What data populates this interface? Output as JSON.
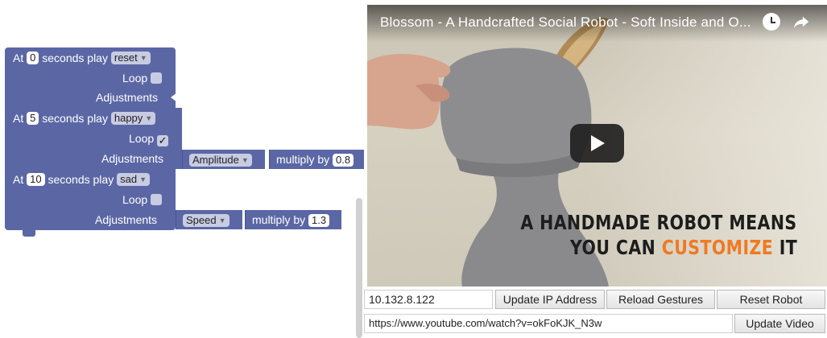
{
  "blocks": [
    {
      "prefix": "At",
      "seconds": "0",
      "mid": "seconds play",
      "gesture": "reset",
      "loop_label": "Loop",
      "loop_checked": "",
      "adjust_label": "Adjustments"
    },
    {
      "prefix": "At",
      "seconds": "5",
      "mid": "seconds play",
      "gesture": "happy",
      "loop_label": "Loop",
      "loop_checked": "✓",
      "adjust_label": "Adjustments",
      "adjust_param": "Amplitude",
      "multiply_label": "multiply by",
      "multiply_value": "0.8"
    },
    {
      "prefix": "At",
      "seconds": "10",
      "mid": "seconds play",
      "gesture": "sad",
      "loop_label": "Loop",
      "loop_checked": "",
      "adjust_label": "Adjustments",
      "adjust_param": "Speed",
      "multiply_label": "multiply by",
      "multiply_value": "1.3"
    }
  ],
  "video": {
    "title": "Blossom - A Handcrafted Social Robot - Soft Inside and O...",
    "overlay_line1": "A HANDMADE ROBOT MEANS",
    "overlay_line2_a": "YOU CAN ",
    "overlay_line2_b": "CUSTOMIZE",
    "overlay_line2_c": " IT",
    "accent_color": "#ee7a22",
    "icons": [
      "clock-icon",
      "share-icon",
      "play-icon"
    ]
  },
  "controls": {
    "ip_value": "10.132.8.122",
    "update_ip_label": "Update IP Address",
    "reload_label": "Reload Gestures",
    "reset_label": "Reset Robot",
    "url_value": "https://www.youtube.com/watch?v=okFoKJK_N3w",
    "update_video_label": "Update Video"
  },
  "colors": {
    "block": "#5b67a5",
    "dropdown": "#c8cce3"
  }
}
